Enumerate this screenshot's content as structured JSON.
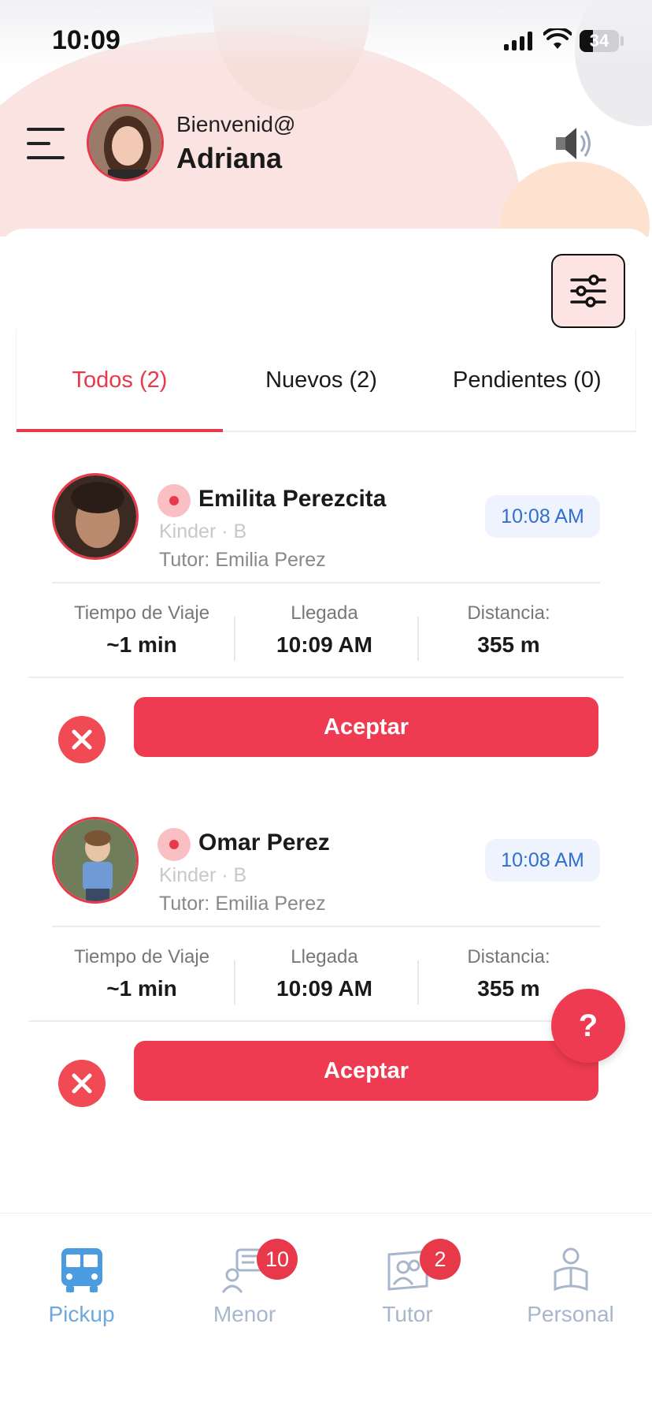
{
  "status_bar": {
    "time": "10:09",
    "battery": "34",
    "battery_level": 0.34
  },
  "header": {
    "welcome": "Bienvenid@",
    "user_name": "Adriana"
  },
  "tabs": [
    {
      "label": "Todos (2)",
      "active": true
    },
    {
      "label": "Nuevos (2)",
      "active": false
    },
    {
      "label": "Pendientes (0)",
      "active": false
    }
  ],
  "requests": [
    {
      "name": "Emilita Perezcita",
      "grade": "Kinder · B",
      "tutor": "Tutor: Emilia Perez",
      "time": "10:08 AM",
      "stats": [
        {
          "label": "Tiempo de Viaje",
          "value": "~1 min"
        },
        {
          "label": "Llegada",
          "value": "10:09 AM"
        },
        {
          "label": "Distancia:",
          "value": "355 m"
        }
      ],
      "accept_label": "Aceptar"
    },
    {
      "name": "Omar Perez",
      "grade": "Kinder · B",
      "tutor": "Tutor: Emilia Perez",
      "time": "10:08 AM",
      "stats": [
        {
          "label": "Tiempo de Viaje",
          "value": "~1 min"
        },
        {
          "label": "Llegada",
          "value": "10:09 AM"
        },
        {
          "label": "Distancia:",
          "value": "355 m"
        }
      ],
      "accept_label": "Aceptar"
    }
  ],
  "help": {
    "label": "?"
  },
  "bottom_nav": [
    {
      "label": "Pickup",
      "icon": "bus-icon",
      "active": true
    },
    {
      "label": "Menor",
      "icon": "chat-person-icon",
      "badge": "10"
    },
    {
      "label": "Tutor",
      "icon": "tutor-card-icon",
      "badge": "2"
    },
    {
      "label": "Personal",
      "icon": "person-book-icon"
    }
  ],
  "colors": {
    "accent": "#ee3b51",
    "nav_active": "#6fa8dc",
    "nav_inactive": "#a8b6cc",
    "time_badge": "#2f6fd0"
  }
}
